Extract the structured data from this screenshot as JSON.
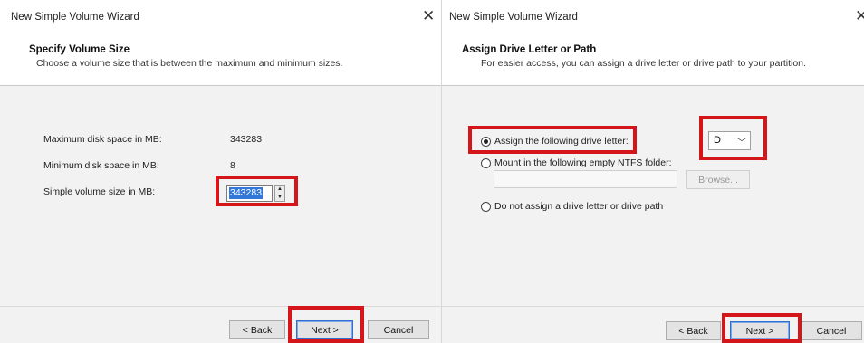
{
  "left": {
    "window_title": "New Simple Volume Wizard",
    "close_glyph": "✕",
    "header_title": "Specify Volume Size",
    "header_subtitle": "Choose a volume size that is between the maximum and minimum sizes.",
    "max_label": "Maximum disk space in MB:",
    "max_value": "343283",
    "min_label": "Minimum disk space in MB:",
    "min_value": "8",
    "size_label": "Simple volume size in MB:",
    "size_value": "343283",
    "spin_up_icon": "▲",
    "spin_down_icon": "▼",
    "back_label": "< Back",
    "next_label": "Next >",
    "cancel_label": "Cancel"
  },
  "right": {
    "window_title": "New Simple Volume Wizard",
    "close_glyph": "✕",
    "header_title": "Assign Drive Letter or Path",
    "header_subtitle": "For easier access, you can assign a drive letter or drive path to your partition.",
    "options": [
      {
        "label": "Assign the following drive letter:",
        "selected": true
      },
      {
        "label": "Mount in the following empty NTFS folder:",
        "selected": false
      },
      {
        "label": "Do not assign a drive letter or drive path",
        "selected": false
      }
    ],
    "drive_letter": "D",
    "combo_arrow_icon": "﹀",
    "browse_label": "Browse...",
    "back_label": "< Back",
    "next_label": "Next >",
    "cancel_label": "Cancel"
  },
  "colors": {
    "highlight": "#d4161b",
    "selection": "#3377d8",
    "panel_bg": "#f2f2f2"
  }
}
